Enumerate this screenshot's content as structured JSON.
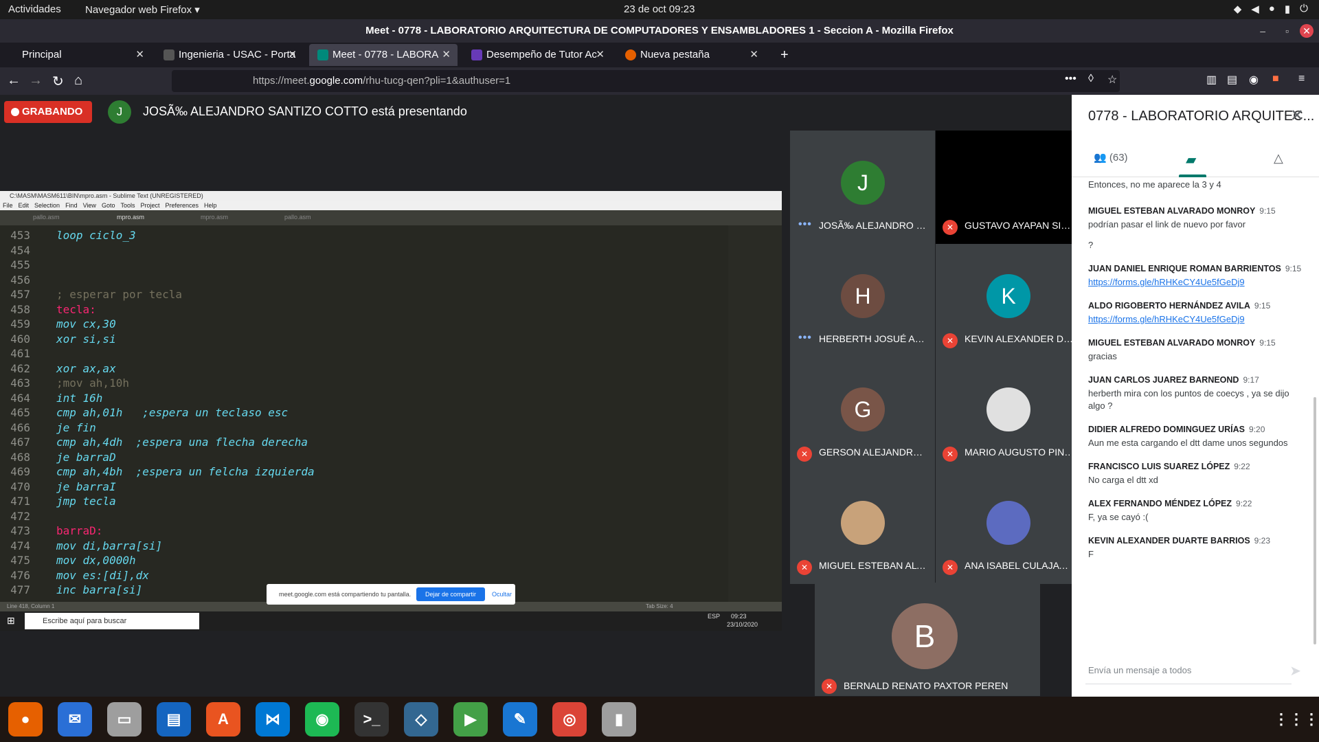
{
  "system": {
    "activities": "Actividades",
    "browser_menu": "Navegador web Firefox ▾",
    "datetime": "23 de oct  09:23"
  },
  "window": {
    "title": "Meet - 0778 - LABORATORIO ARQUITECTURA DE COMPUTADORES Y ENSAMBLADORES 1 - Seccion A - Mozilla Firefox"
  },
  "tabs": [
    {
      "label": "Principal"
    },
    {
      "label": "Ingenieria - USAC - Porta"
    },
    {
      "label": "Meet - 0778 - LABORA"
    },
    {
      "label": "Desempeño de Tutor Ac"
    },
    {
      "label": "Nueva pestaña"
    }
  ],
  "url": {
    "prefix": "https://meet.",
    "host": "google.com",
    "path": "/rhu-tucg-qen?pli=1&authuser=1"
  },
  "meet": {
    "recording": "GRABANDO",
    "presenter_initial": "J",
    "presenting_text": "JOSÃ‰ ALEJANDRO SANTIZO COTTO está presentando"
  },
  "shared": {
    "title": "C:\\MASM\\MASM611\\BIN\\mpro.asm - Sublime Text (UNREGISTERED)",
    "menu": [
      "File",
      "Edit",
      "Selection",
      "Find",
      "View",
      "Goto",
      "Tools",
      "Project",
      "Preferences",
      "Help"
    ],
    "file_tabs": [
      "pallo.asm",
      "mpro.asm",
      "mpro.asm",
      "pallo.asm"
    ],
    "share_note": "meet.google.com está compartiendo tu pantalla.",
    "share_stop": "Dejar de compartir",
    "share_hide": "Ocultar",
    "status_left": "Line 418, Column 1",
    "status_right": "Tab Size: 4",
    "search_placeholder": "Escribe aquí para buscar",
    "win_clock": "09:23",
    "win_date": "23/10/2020",
    "win_lang": "ESP",
    "code": [
      {
        "n": "453",
        "t": "loop ciclo_3",
        "c": "kw"
      },
      {
        "n": "454",
        "t": "",
        "c": ""
      },
      {
        "n": "455",
        "t": "",
        "c": ""
      },
      {
        "n": "456",
        "t": "",
        "c": ""
      },
      {
        "n": "457",
        "t": "; esperar por tecla",
        "c": "cmt"
      },
      {
        "n": "458",
        "t": "tecla:",
        "c": "lbl"
      },
      {
        "n": "459",
        "t": "mov cx,30",
        "c": "kw"
      },
      {
        "n": "460",
        "t": "xor si,si",
        "c": "kw"
      },
      {
        "n": "461",
        "t": "",
        "c": ""
      },
      {
        "n": "462",
        "t": "xor ax,ax",
        "c": "kw"
      },
      {
        "n": "463",
        "t": ";mov ah,10h",
        "c": "cmt"
      },
      {
        "n": "464",
        "t": "int 16h",
        "c": "kw"
      },
      {
        "n": "465",
        "t": "cmp ah,01h   ;espera un teclaso esc",
        "c": "kw"
      },
      {
        "n": "466",
        "t": "je fin",
        "c": "kw"
      },
      {
        "n": "467",
        "t": "cmp ah,4dh  ;espera una flecha derecha",
        "c": "kw"
      },
      {
        "n": "468",
        "t": "je barraD",
        "c": "kw"
      },
      {
        "n": "469",
        "t": "cmp ah,4bh  ;espera un felcha izquierda",
        "c": "kw"
      },
      {
        "n": "470",
        "t": "je barraI",
        "c": "kw"
      },
      {
        "n": "471",
        "t": "jmp tecla",
        "c": "kw"
      },
      {
        "n": "472",
        "t": "",
        "c": ""
      },
      {
        "n": "473",
        "t": "barraD:",
        "c": "lbl"
      },
      {
        "n": "474",
        "t": "mov di,barra[si]",
        "c": "kw"
      },
      {
        "n": "475",
        "t": "mov dx,0000h",
        "c": "kw"
      },
      {
        "n": "476",
        "t": "mov es:[di],dx",
        "c": "kw"
      },
      {
        "n": "477",
        "t": "inc barra[si]",
        "c": "kw"
      }
    ]
  },
  "participants": [
    {
      "initial": "J",
      "name": "JOSÃ‰ ALEJANDRO S...",
      "color": "#2e7d32",
      "muted": false
    },
    {
      "initial": "",
      "name": "GUSTAVO AYAPAN SIN...",
      "color": "#000000",
      "muted": true
    },
    {
      "initial": "H",
      "name": "HERBERTH JOSUÉ ARG...",
      "color": "#6d4c41",
      "muted": false
    },
    {
      "initial": "K",
      "name": "KEVIN ALEXANDER DU...",
      "color": "#0097a7",
      "muted": true
    },
    {
      "initial": "G",
      "name": "GERSON ALEJANDRO B...",
      "color": "#795548",
      "muted": true
    },
    {
      "initial": "",
      "name": "MARIO AUGUSTO PINE...",
      "color": "#e0e0e0",
      "muted": true
    },
    {
      "initial": "",
      "name": "MIGUEL ESTEBAN ALVA...",
      "color": "#c8a27a",
      "muted": true
    },
    {
      "initial": "",
      "name": "ANA ISABEL CULAJAY ...",
      "color": "#5c6bc0",
      "muted": true
    },
    {
      "initial": "B",
      "name": "BERNALD RENATO PAXTOR PEREN",
      "color": "#8d6e63",
      "muted": true
    }
  ],
  "panel": {
    "title": "0778 - LABORATORIO ARQUITEC...",
    "people_count": "(63)",
    "compose_placeholder": "Envía un mensaje a todos",
    "first_line": "Entonces, no me aparece la 3 y 4",
    "messages": [
      {
        "who": "MIGUEL ESTEBAN ALVARADO MONROY",
        "time": "9:15",
        "text": "podrían pasar el link de nuevo por favor",
        "extra": "?"
      },
      {
        "who": "JUAN DANIEL ENRIQUE ROMAN BARRIENTOS",
        "time": "9:15",
        "link": "https://forms.gle/hRHKeCY4Ue5fGeDj9"
      },
      {
        "who": "ALDO RIGOBERTO HERNÁNDEZ AVILA",
        "time": "9:15",
        "link": "https://forms.gle/hRHKeCY4Ue5fGeDj9"
      },
      {
        "who": "MIGUEL ESTEBAN ALVARADO MONROY",
        "time": "9:15",
        "text": "gracias"
      },
      {
        "who": "JUAN CARLOS JUAREZ BARNEOND",
        "time": "9:17",
        "text": "herberth mira con los puntos de coecys , ya se dijo algo ?"
      },
      {
        "who": "DIDIER ALFREDO DOMINGUEZ URÍAS",
        "time": "9:20",
        "text": "Aun me esta cargando el dtt dame unos segundos"
      },
      {
        "who": "FRANCISCO LUIS SUAREZ LÓPEZ",
        "time": "9:22",
        "text": "No carga el dtt xd"
      },
      {
        "who": "ALEX FERNANDO MÉNDEZ LÓPEZ",
        "time": "9:22",
        "text": "F, ya se cayó :("
      },
      {
        "who": "KEVIN ALEXANDER DUARTE BARRIOS",
        "time": "9:23",
        "text": "F"
      }
    ]
  },
  "dock": [
    {
      "name": "firefox-icon",
      "color": "#e66000"
    },
    {
      "name": "thunderbird-icon",
      "color": "#2a6fd6"
    },
    {
      "name": "files-icon",
      "color": "#9e9e9e"
    },
    {
      "name": "writer-icon",
      "color": "#1565c0"
    },
    {
      "name": "software-icon",
      "color": "#e95420"
    },
    {
      "name": "vscode-icon",
      "color": "#0078d4"
    },
    {
      "name": "spotify-icon",
      "color": "#1db954"
    },
    {
      "name": "terminal-icon",
      "color": "#333333"
    },
    {
      "name": "mysql-workbench-icon",
      "color": "#336791"
    },
    {
      "name": "media-icon",
      "color": "#43a047"
    },
    {
      "name": "text-editor-icon",
      "color": "#1976d2"
    },
    {
      "name": "chrome-icon",
      "color": "#db4437"
    },
    {
      "name": "sd-card-icon",
      "color": "#9e9e9e"
    }
  ]
}
